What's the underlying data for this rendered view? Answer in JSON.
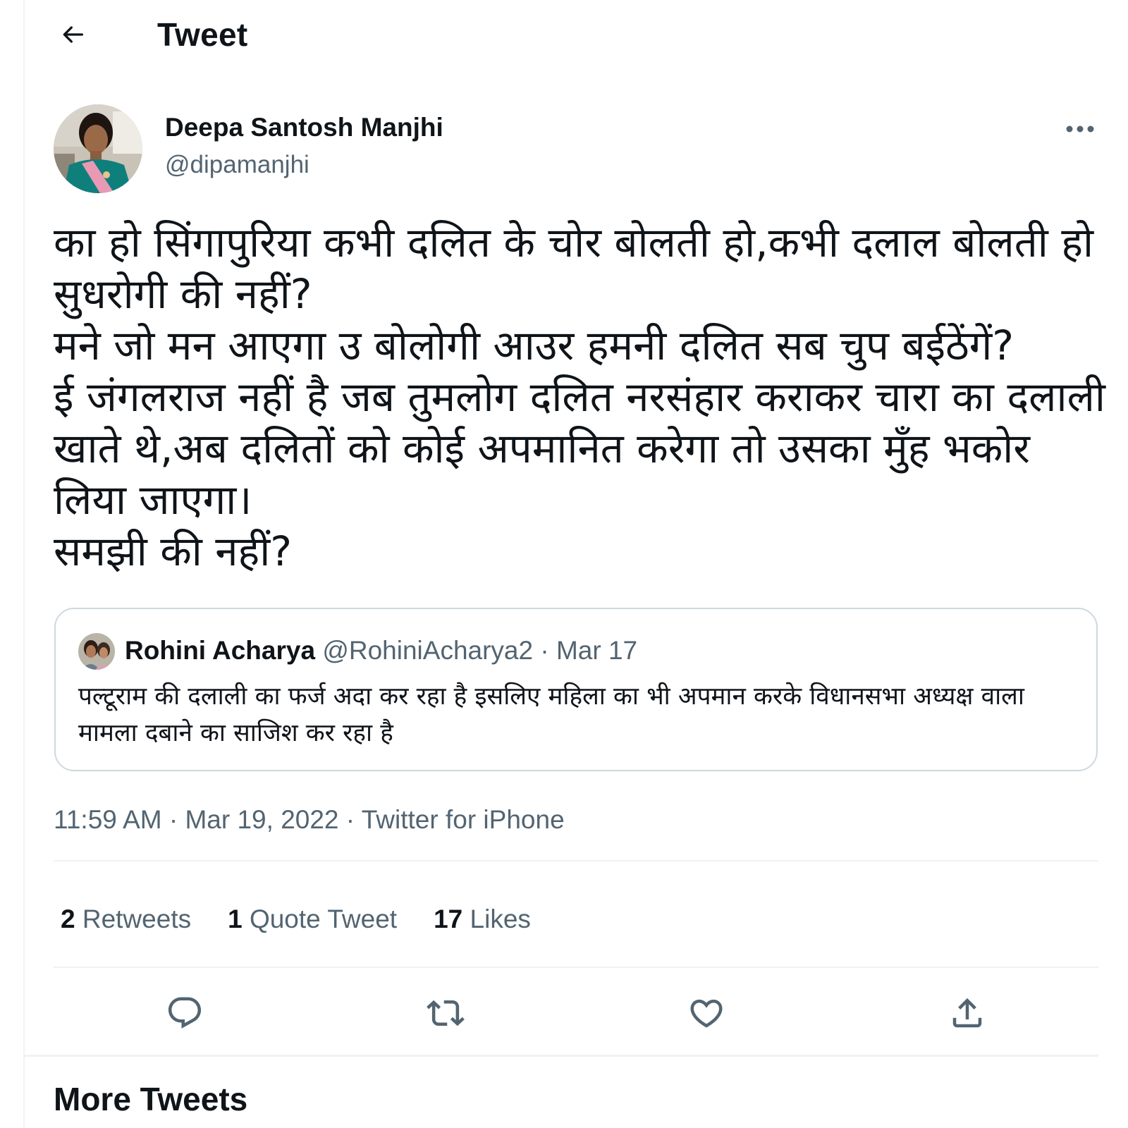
{
  "header": {
    "title": "Tweet"
  },
  "author": {
    "name": "Deepa Santosh Manjhi",
    "handle": "@dipamanjhi"
  },
  "tweet": {
    "text": "का हो सिंगापुरिया कभी दलित के चोर बोलती हो,कभी दलाल बोलती हो सुधरोगी की नहीं?\nमने जो मन आएगा उ बोलोगी आउर हमनी दलित सब चुप बईठेंगें?\nई जंगलराज नहीं है जब तुमलोग दलित नरसंहार कराकर चारा का दलाली खाते थे,अब दलितों को कोई अपमानित करेगा तो उसका मुँह भकोर लिया जाएगा।\nसमझी की नहीं?"
  },
  "quote": {
    "name": "Rohini Acharya",
    "meta": "@RohiniAcharya2 · Mar 17",
    "text": "पल्टूराम की दलाली का फर्ज अदा कर रहा है इसलिए महिला का भी अपमान करके विधानसभा अध्यक्ष वाला मामला दबाने का साजिश कर रहा है"
  },
  "meta": {
    "time": "11:59 AM",
    "separator": " · ",
    "date": "Mar 19, 2022",
    "source": "Twitter for iPhone"
  },
  "stats": {
    "retweets": {
      "count": "2",
      "label": "Retweets"
    },
    "quotes": {
      "count": "1",
      "label": "Quote Tweet"
    },
    "likes": {
      "count": "17",
      "label": "Likes"
    }
  },
  "more_tweets": {
    "title": "More Tweets"
  },
  "icons": {
    "back": "arrow-left-icon",
    "more": "ellipsis-icon",
    "reply": "reply-icon",
    "retweet": "retweet-icon",
    "like": "heart-icon",
    "share": "share-icon"
  },
  "colors": {
    "text": "#0f1419",
    "secondary": "#536471",
    "border": "#cfd9de",
    "divider": "#eff3f4"
  }
}
